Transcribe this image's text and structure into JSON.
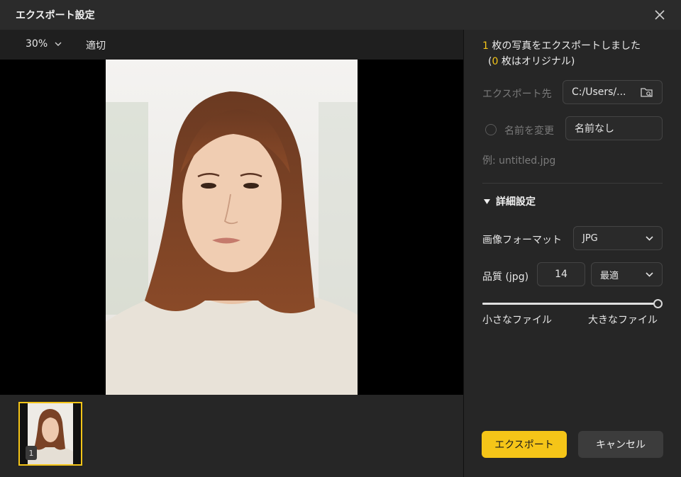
{
  "window": {
    "title": "エクスポート設定"
  },
  "toolbar": {
    "zoom": "30%",
    "fit": "適切"
  },
  "filmstrip": {
    "thumb_index": "1"
  },
  "summary": {
    "count": "1",
    "line1_rest": " 枚の写真をエクスポートしました",
    "line2_open": "(",
    "original_count": "0",
    "line2_rest": " 枚はオリジナル)"
  },
  "export_dest": {
    "label": "エクスポート先",
    "path": "C:/Users/..."
  },
  "rename": {
    "label": "名前を変更",
    "value": "名前なし",
    "example": "例: untitled.jpg"
  },
  "details": {
    "title": "詳細設定"
  },
  "format": {
    "label": "画像フォーマット",
    "value": "JPG"
  },
  "quality": {
    "label": "品質 (jpg)",
    "value": "14",
    "preset": "最適",
    "slider_fraction": 1.0
  },
  "slider_labels": {
    "small": "小さなファイル",
    "large": "大きなファイル"
  },
  "buttons": {
    "export": "エクスポート",
    "cancel": "キャンセル"
  },
  "colors": {
    "accent": "#f5c518",
    "panel": "#262626",
    "titlebar": "#2b2b2b"
  },
  "icons": {
    "close": "close-icon",
    "zoom": "chevron-down-icon",
    "folder": "folder-search-icon",
    "section": "triangle-down-icon",
    "dropdown": "chevron-down-icon"
  }
}
